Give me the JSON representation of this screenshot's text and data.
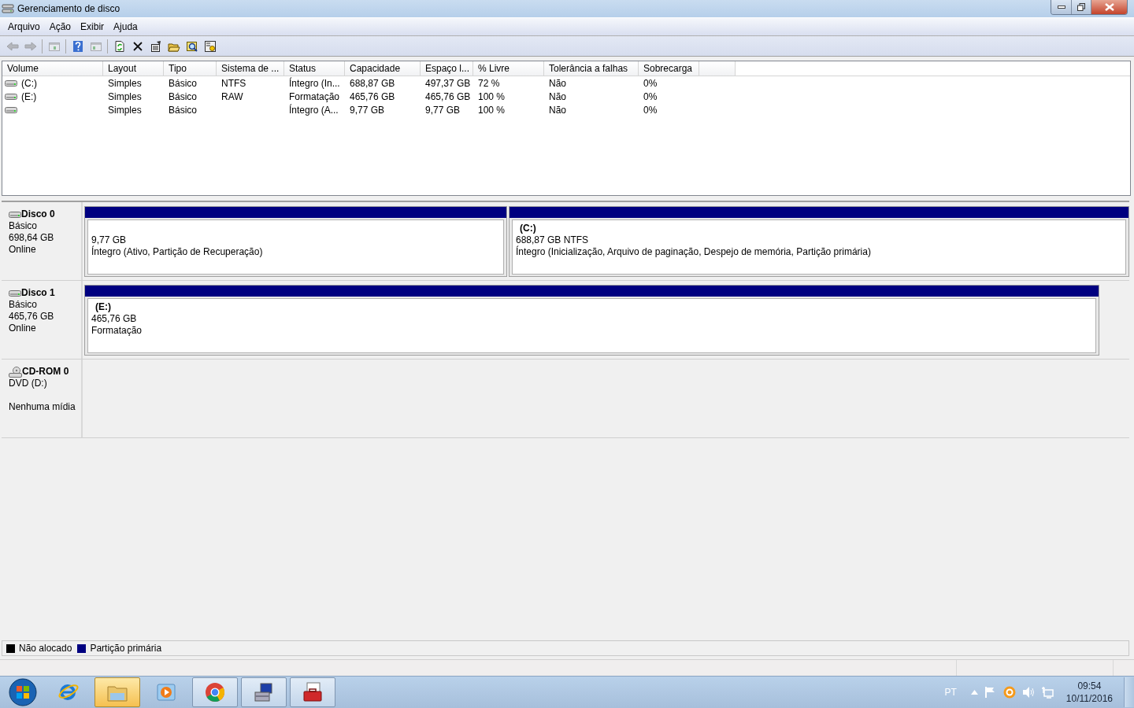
{
  "window": {
    "title": "Gerenciamento de disco"
  },
  "menu": [
    "Arquivo",
    "Ação",
    "Exibir",
    "Ajuda"
  ],
  "toolbar": [
    {
      "kind": "back",
      "disabled": true
    },
    {
      "kind": "forward",
      "disabled": true
    },
    {
      "kind": "sep"
    },
    {
      "kind": "tree",
      "disabled": true
    },
    {
      "kind": "sep"
    },
    {
      "kind": "help",
      "disabled": false
    },
    {
      "kind": "pane",
      "disabled": true
    },
    {
      "kind": "sep"
    },
    {
      "kind": "refresh",
      "disabled": false
    },
    {
      "kind": "delete",
      "disabled": false
    },
    {
      "kind": "properties",
      "disabled": false
    },
    {
      "kind": "open",
      "disabled": false
    },
    {
      "kind": "search",
      "disabled": false
    },
    {
      "kind": "settings",
      "disabled": false
    }
  ],
  "table": {
    "columns": [
      "Volume",
      "Layout",
      "Tipo",
      "Sistema de ...",
      "Status",
      "Capacidade",
      "Espaço l...",
      "% Livre",
      "Tolerância a falhas",
      "Sobrecarga"
    ],
    "rows": [
      {
        "cells": [
          "(C:)",
          "Simples",
          "Básico",
          "NTFS",
          "Íntegro (In...",
          "688,87 GB",
          "497,37 GB",
          "72 %",
          "Não",
          "0%"
        ]
      },
      {
        "cells": [
          "(E:)",
          "Simples",
          "Básico",
          "RAW",
          "Formatação",
          "465,76 GB",
          "465,76 GB",
          "100 %",
          "Não",
          "0%"
        ]
      },
      {
        "cells": [
          null,
          "Simples",
          "Básico",
          null,
          "Íntegro (A...",
          "9,77 GB",
          "9,77 GB",
          "100 %",
          "Não",
          "0%"
        ]
      }
    ]
  },
  "disks": [
    {
      "kind": "disk",
      "name": "Disco 0",
      "lines": [
        "Básico",
        "698,64 GB",
        "Online"
      ],
      "partitions": [
        {
          "lines": [
            "9,77 GB",
            "Íntegro (Ativo, Partição de Recuperação)"
          ]
        },
        {
          "drive": "(C:)",
          "lines": [
            "688,87 GB NTFS",
            "Íntegro (Inicialização, Arquivo de paginação, Despejo de memória, Partição primária)"
          ]
        }
      ]
    },
    {
      "kind": "disk",
      "name": "Disco 1",
      "lines": [
        "Básico",
        "465,76 GB",
        "Online"
      ],
      "partitions": [
        {
          "drive": "(E:)",
          "lines": [
            "465,76 GB",
            "Formatação"
          ]
        }
      ]
    },
    {
      "kind": "cdrom",
      "name": "CD-ROM 0",
      "lines": [
        "DVD (D:)",
        "Nenhuma mídia"
      ]
    }
  ],
  "legend": [
    {
      "label": "Não alocado",
      "color": "#000000"
    },
    {
      "label": "Partição primária",
      "color": "#000080"
    }
  ],
  "taskbar": {
    "apps": [
      {
        "kind": "ie",
        "running": false
      },
      {
        "kind": "explorer",
        "running": true
      },
      {
        "kind": "media",
        "running": false
      },
      {
        "kind": "chrome",
        "running": true
      },
      {
        "kind": "computer",
        "running": true
      },
      {
        "kind": "toolbox",
        "running": true
      }
    ],
    "language": "PT",
    "time": "09:54",
    "date": "10/11/2016"
  }
}
